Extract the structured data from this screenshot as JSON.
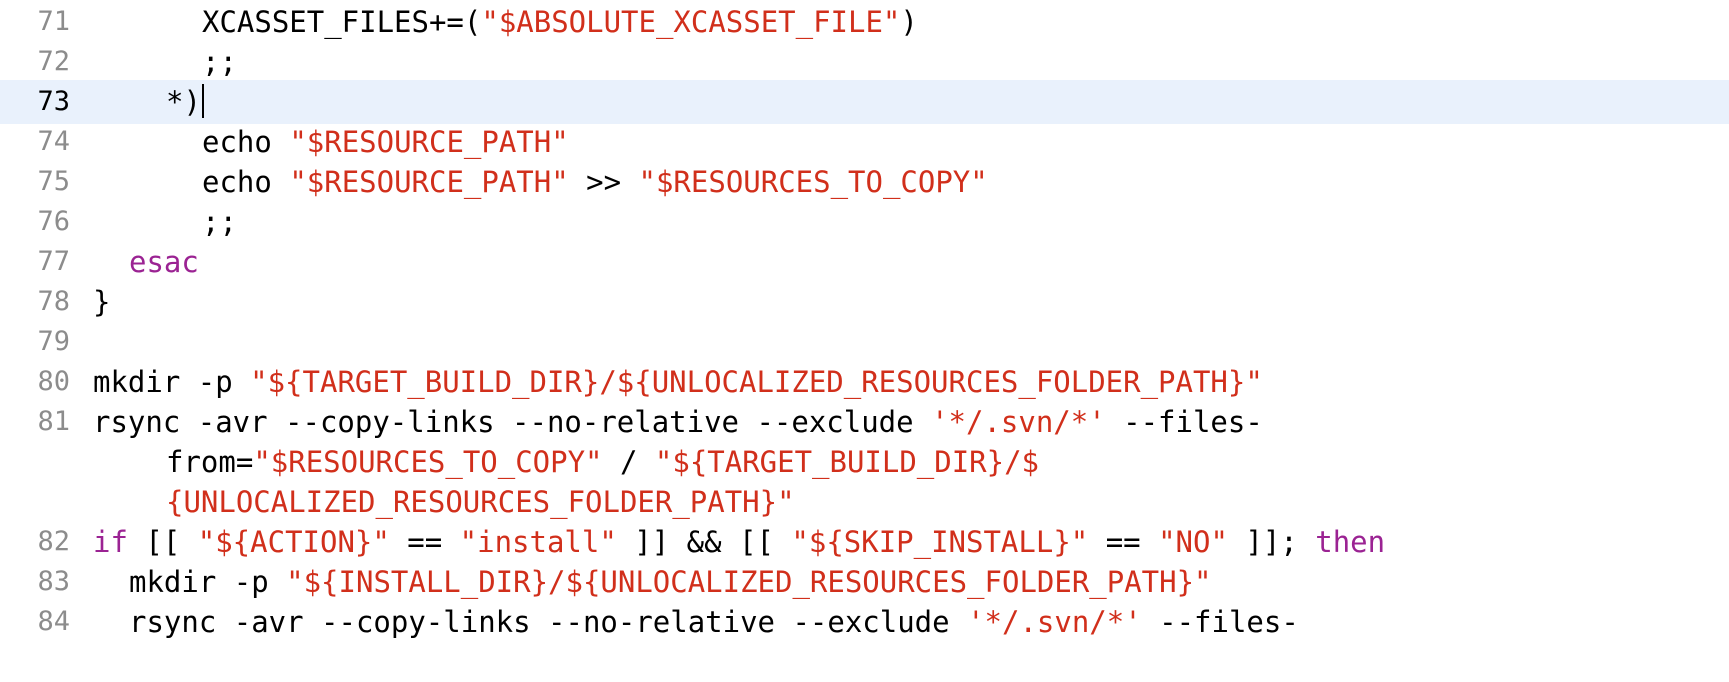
{
  "editor": {
    "current_line": "73",
    "colors": {
      "string": "#d12f1b",
      "keyword": "#9b2393",
      "line_highlight": "#e9f1fc",
      "gutter": "#8c8c8c"
    },
    "lines": {
      "l71": {
        "num": "71",
        "t1": "XCASSET_FILES+=(",
        "t2": "\"$ABSOLUTE_XCASSET_FILE\"",
        "t3": ")"
      },
      "l72": {
        "num": "72",
        "t1": ";;"
      },
      "l73": {
        "num": "73",
        "t1": "*)"
      },
      "l74": {
        "num": "74",
        "t1": "echo ",
        "t2": "\"$RESOURCE_PATH\""
      },
      "l75": {
        "num": "75",
        "t1": "echo ",
        "t2": "\"$RESOURCE_PATH\"",
        "t3": " >> ",
        "t4": "\"$RESOURCES_TO_COPY\""
      },
      "l76": {
        "num": "76",
        "t1": ";;"
      },
      "l77": {
        "num": "77",
        "t1": "esac"
      },
      "l78": {
        "num": "78",
        "t1": "}"
      },
      "l79": {
        "num": "79"
      },
      "l80": {
        "num": "80",
        "t1": "mkdir -p ",
        "t2": "\"${TARGET_BUILD_DIR}/${UNLOCALIZED_RESOURCES_FOLDER_PATH}\""
      },
      "l81": {
        "num": "81",
        "t1": "rsync -avr --copy-links --no-relative --exclude ",
        "t2": "'*/.svn/*'",
        "t3": " --files-"
      },
      "l81b": {
        "t1": "from=",
        "t2": "\"$RESOURCES_TO_COPY\"",
        "t3": " / ",
        "t4": "\"${TARGET_BUILD_DIR}/$"
      },
      "l81c": {
        "t1": "{UNLOCALIZED_RESOURCES_FOLDER_PATH}\""
      },
      "l82": {
        "num": "82",
        "t1": "if",
        "t2": " [[ ",
        "t3": "\"${ACTION}\"",
        "t4": " == ",
        "t5": "\"install\"",
        "t6": " ]] && [[ ",
        "t7": "\"${SKIP_INSTALL}\"",
        "t8": " == ",
        "t9": "\"NO\"",
        "t10": " ]]; ",
        "t11": "then"
      },
      "l83": {
        "num": "83",
        "t1": "mkdir -p ",
        "t2": "\"${INSTALL_DIR}/${UNLOCALIZED_RESOURCES_FOLDER_PATH}\""
      },
      "l84": {
        "num": "84",
        "t1": "rsync -avr --copy-links --no-relative --exclude ",
        "t2": "'*/.svn/*'",
        "t3": " --files-"
      }
    }
  }
}
